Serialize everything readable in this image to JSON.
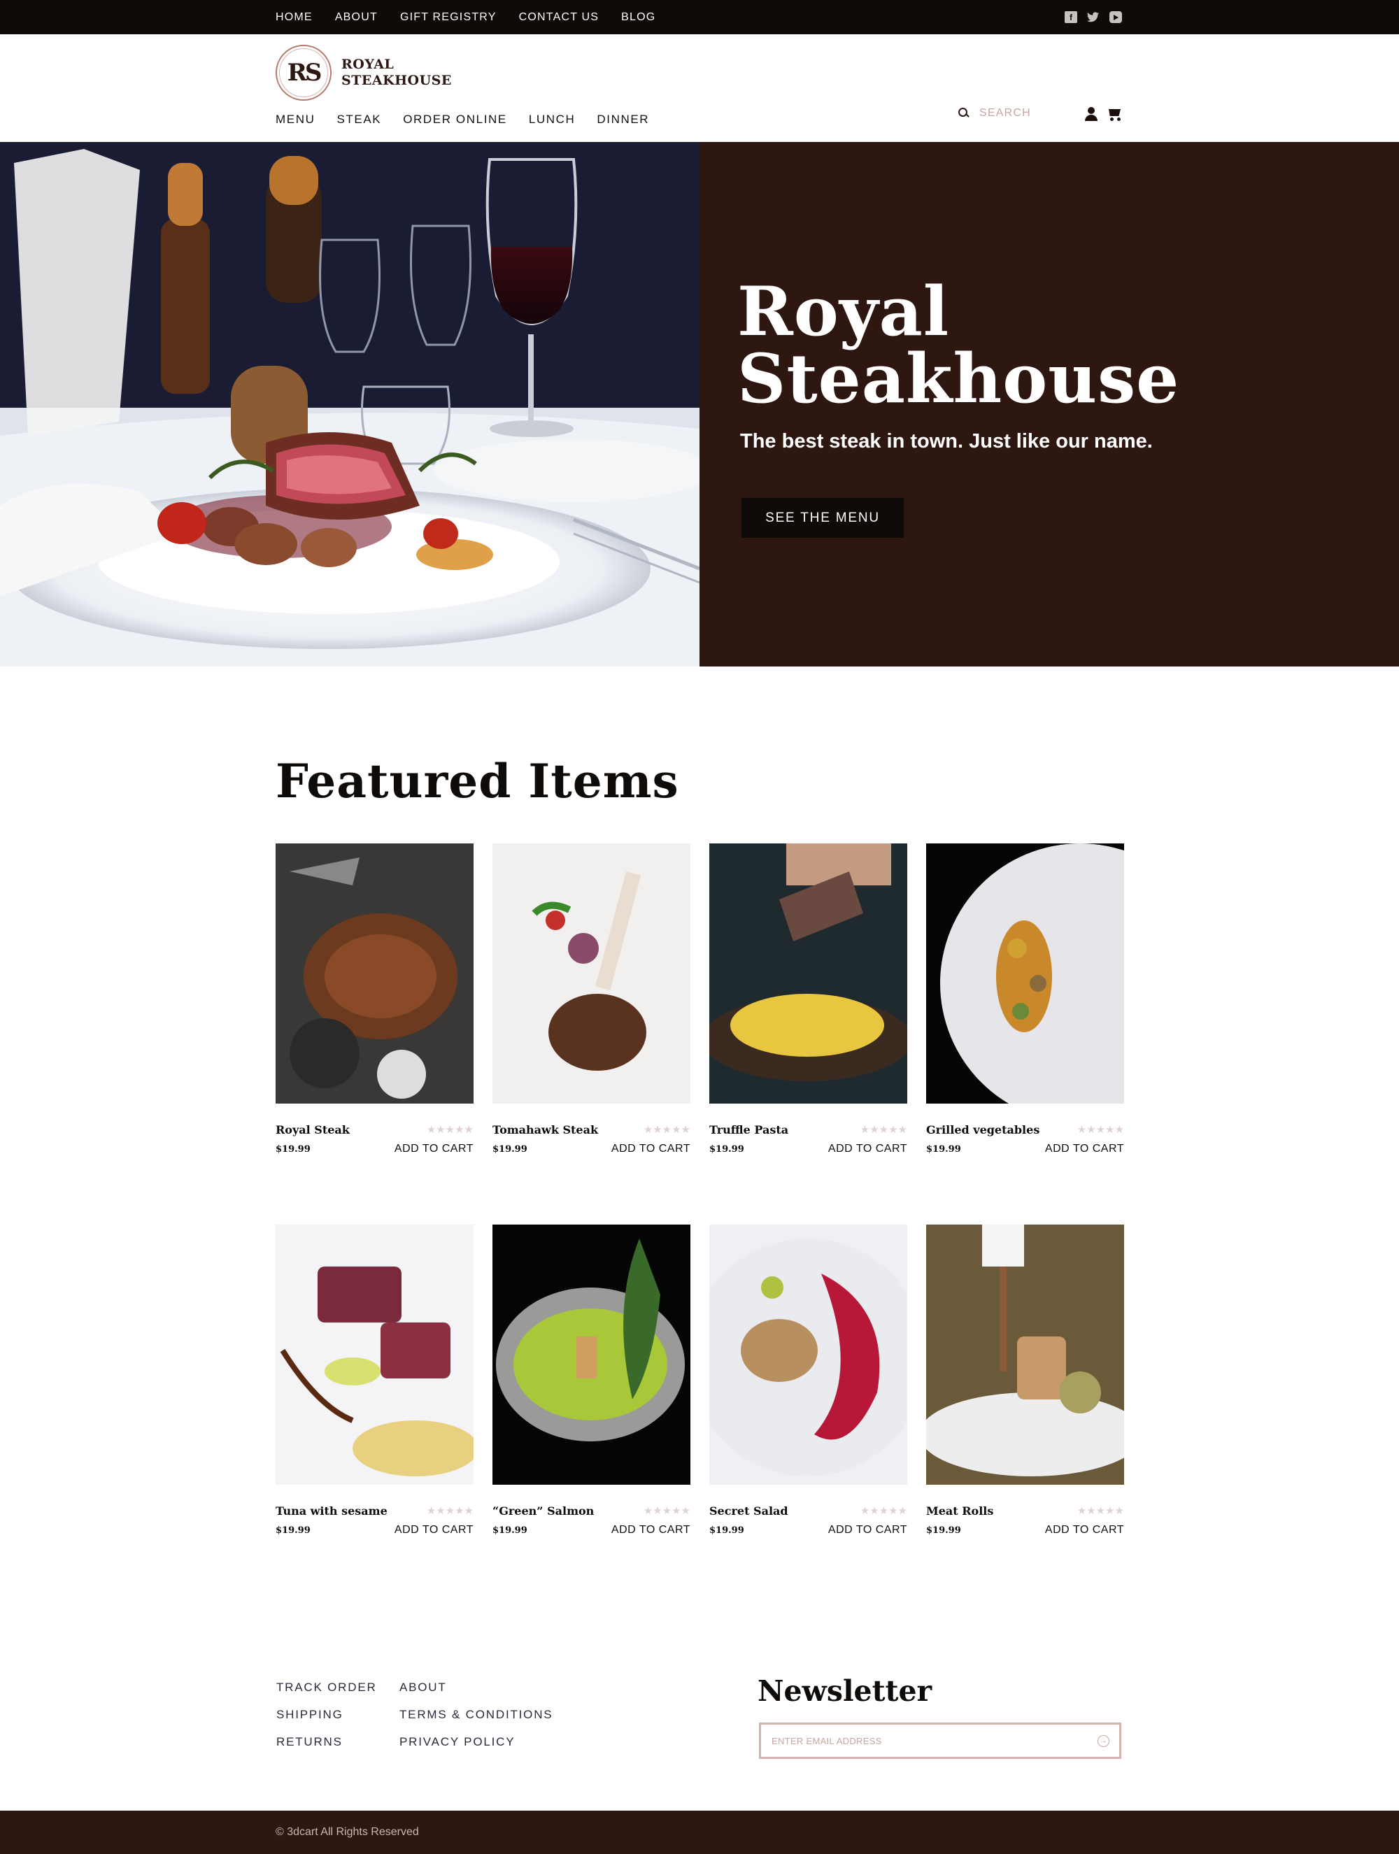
{
  "topbar": {
    "links": [
      "HOME",
      "ABOUT",
      "GIFT REGISTRY",
      "CONTACT US",
      "BLOG"
    ],
    "social_icons": [
      "facebook-icon",
      "twitter-icon",
      "youtube-icon"
    ]
  },
  "header": {
    "logo_monogram": "RS",
    "logo_line1": "ROYAL",
    "logo_line2": "STEAKHOUSE",
    "nav": [
      "MENU",
      "STEAK",
      "ORDER ONLINE",
      "LUNCH",
      "DINNER"
    ],
    "search_placeholder": "SEARCH"
  },
  "hero": {
    "title_line1": "Royal",
    "title_line2": "Steakhouse",
    "tagline": "The best steak in town. Just like our name.",
    "button_label": "SEE THE MENU",
    "panel_color": "#2f1711"
  },
  "featured": {
    "title": "Featured Items",
    "products": [
      {
        "name": "Royal Steak",
        "price": "$19.99",
        "cta": "ADD TO CART",
        "rating": 0
      },
      {
        "name": "Tomahawk Steak",
        "price": "$19.99",
        "cta": "ADD TO CART",
        "rating": 0
      },
      {
        "name": "Truffle Pasta",
        "price": "$19.99",
        "cta": "ADD TO CART",
        "rating": 0
      },
      {
        "name": "Grilled vegetables",
        "price": "$19.99",
        "cta": "ADD TO CART",
        "rating": 0
      },
      {
        "name": "Tuna with sesame",
        "price": "$19.99",
        "cta": "ADD TO CART",
        "rating": 0
      },
      {
        "name": "“Green” Salmon",
        "price": "$19.99",
        "cta": "ADD TO CART",
        "rating": 0
      },
      {
        "name": "Secret Salad",
        "price": "$19.99",
        "cta": "ADD TO CART",
        "rating": 0
      },
      {
        "name": "Meat Rolls",
        "price": "$19.99",
        "cta": "ADD TO CART",
        "rating": 0
      }
    ]
  },
  "footer": {
    "col1": [
      "TRACK ORDER",
      "SHIPPING",
      "RETURNS"
    ],
    "col2": [
      "ABOUT",
      "TERMS & CONDITIONS",
      "PRIVACY POLICY"
    ],
    "newsletter_title": "Newsletter",
    "email_placeholder": "ENTER EMAIL ADDRESS",
    "copyright": "© 3dcart All Rights Reserved"
  },
  "colors": {
    "dark": "#0e0b08",
    "brand_brown": "#2f1711",
    "accent_pink": "#d4b5b0"
  }
}
